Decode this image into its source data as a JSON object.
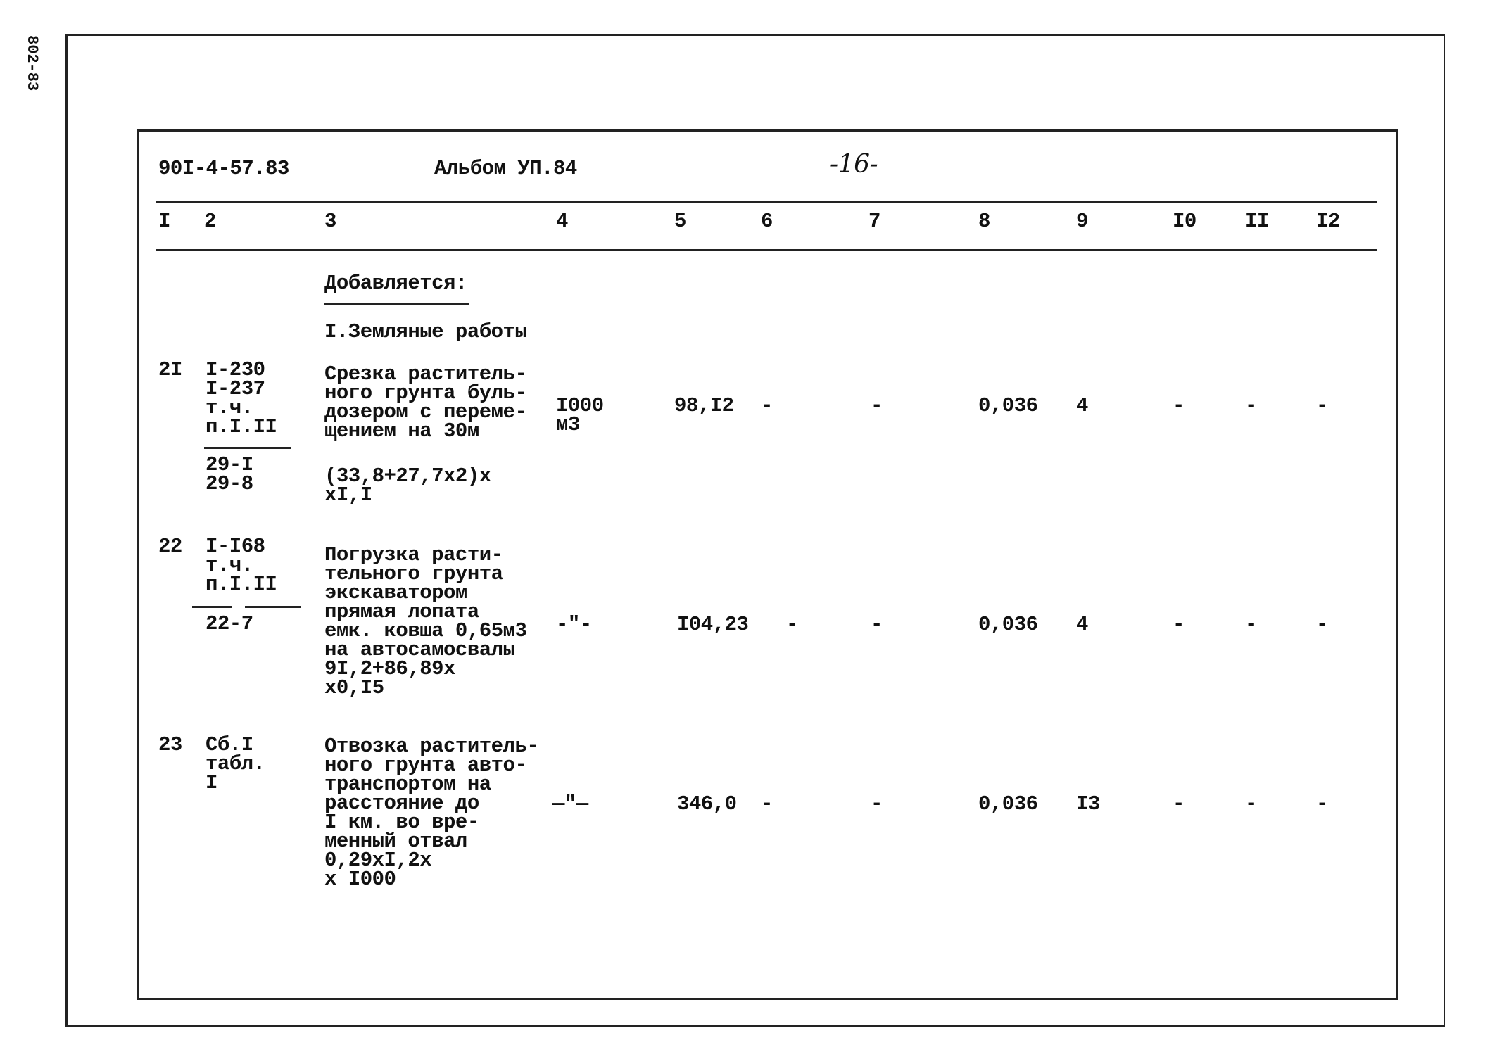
{
  "stamp": "802-83",
  "header": {
    "doc_code": "90I-4-57.83",
    "album": "Альбом УП.84",
    "page_number": "-16-"
  },
  "columns": [
    "I",
    "2",
    "3",
    "4",
    "5",
    "6",
    "7",
    "8",
    "9",
    "I0",
    "II",
    "I2"
  ],
  "intro": "Добавляется:",
  "section_title": "I.Земляные работы",
  "rows": [
    {
      "num": "2I",
      "ref_top": "I-230\nI-237\nт.ч.\nп.I.II",
      "ref_bottom": "29-I\n29-8",
      "description": "Срезка раститель-\nного грунта буль-\nдозером с переме-\nщением на 30м",
      "formula": "(33,8+27,7х2)х\nхI,I",
      "unit": "I000\nм3",
      "c5": "98,I2",
      "c6": "-",
      "c7": "-",
      "c8": "0,036",
      "c9": "4",
      "c10": "-",
      "c11": "-",
      "c12": "-"
    },
    {
      "num": "22",
      "ref_top": "I-I68\nт.ч.\nп.I.II",
      "ref_bottom": "22-7",
      "description": "Погрузка расти-\nтельного грунта\nэкскаватором\nпрямая лопата\nемк. ковша 0,65м3\nна автосамосвалы\n9I,2+86,89х\nх0,I5",
      "unit": "-\"-",
      "c5": "I04,23",
      "c6": "-",
      "c7": "-",
      "c8": "0,036",
      "c9": "4",
      "c10": "-",
      "c11": "-",
      "c12": "-"
    },
    {
      "num": "23",
      "ref_top": "Сб.I\nтабл.\nI",
      "description": "Отвозка раститель-\nного грунта авто-\nтранспортом на\nрасстояние до\nI км. во вре-\nменный отвал\n0,29хI,2х\nх I000",
      "unit": "—\"—",
      "c5": "346,0",
      "c6": "-",
      "c7": "-",
      "c8": "0,036",
      "c9": "I3",
      "c10": "-",
      "c11": "-",
      "c12": "-"
    }
  ]
}
